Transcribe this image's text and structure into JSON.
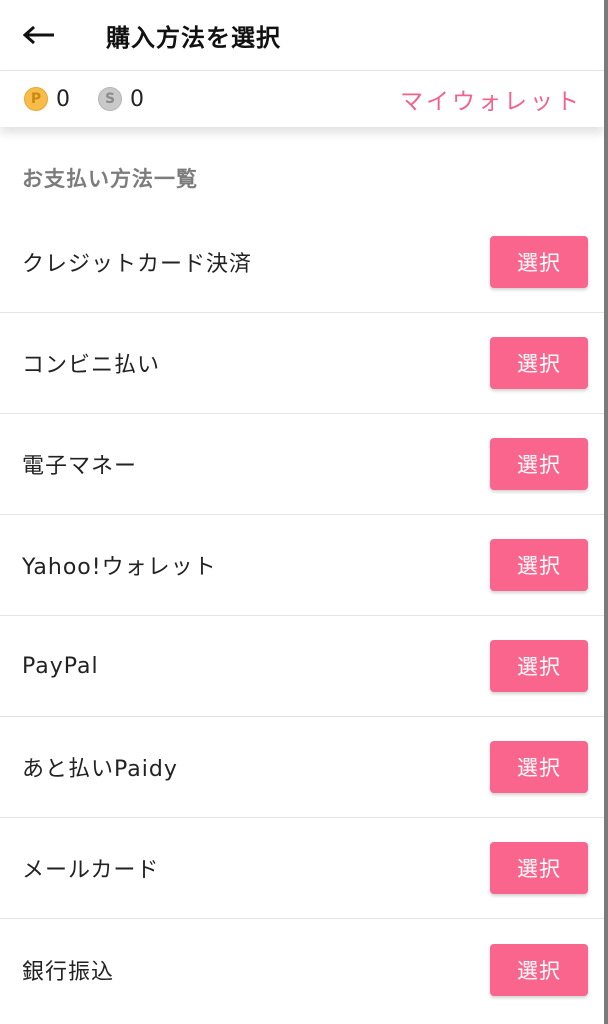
{
  "header": {
    "back_icon": "left-arrow-icon",
    "title": "購入方法を選択"
  },
  "wallet": {
    "points_icon_letter": "P",
    "points_value": "0",
    "points_color": "#f7bc4a",
    "s_icon_letter": "S",
    "s_value": "0",
    "s_color": "#c9c9c9",
    "link_label": "マイウォレット",
    "link_color": "#f0648c"
  },
  "section": {
    "title": "お支払い方法一覧"
  },
  "methods": [
    {
      "label": "クレジットカード決済",
      "button": "選択"
    },
    {
      "label": "コンビニ払い",
      "button": "選択"
    },
    {
      "label": "電子マネー",
      "button": "選択"
    },
    {
      "label": "Yahoo!ウォレット",
      "button": "選択"
    },
    {
      "label": "PayPal",
      "button": "選択"
    },
    {
      "label": "あと払いPaidy",
      "button": "選択"
    },
    {
      "label": "メールカード",
      "button": "選択"
    },
    {
      "label": "銀行振込",
      "button": "選択"
    }
  ],
  "colors": {
    "accent": "#f9658c",
    "section_title": "#7c7c7c",
    "divider": "#e4e4e4"
  }
}
